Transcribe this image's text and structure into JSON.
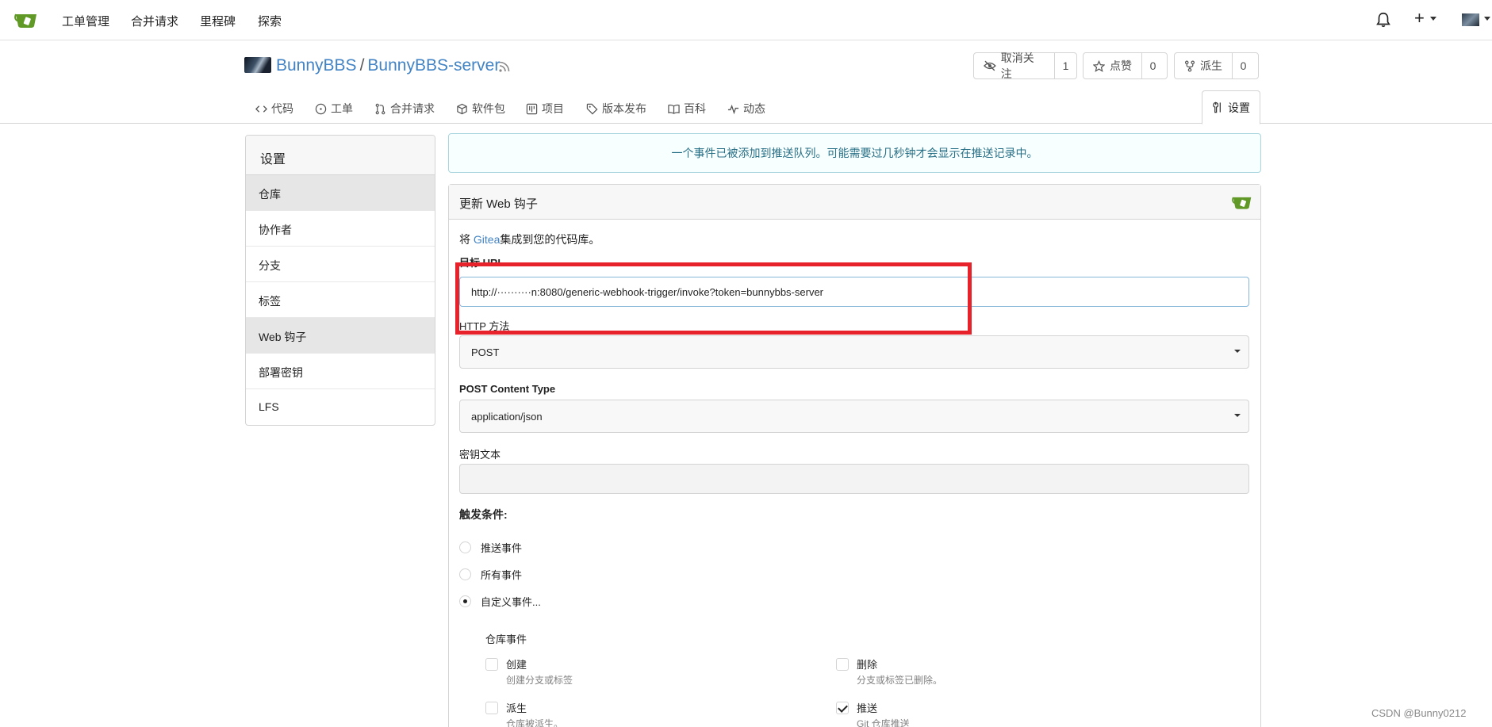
{
  "nav": {
    "items": [
      "工单管理",
      "合并请求",
      "里程碑",
      "探索"
    ]
  },
  "repo": {
    "owner": "BunnyBBS",
    "separator": "/",
    "name": "BunnyBBS-server",
    "unwatch_label": "取消关注",
    "watch_count": "1",
    "star_label": "点赞",
    "star_count": "0",
    "fork_label": "派生",
    "fork_count": "0"
  },
  "tabs": [
    "代码",
    "工单",
    "合并请求",
    "软件包",
    "项目",
    "版本发布",
    "百科",
    "动态"
  ],
  "active_tab": "设置",
  "sidebar": {
    "title": "设置",
    "items": [
      "仓库",
      "协作者",
      "分支",
      "标签",
      "Web 钩子",
      "部署密钥",
      "LFS"
    ]
  },
  "message": "一个事件已被添加到推送队列。可能需要过几秒钟才会显示在推送记录中。",
  "form": {
    "title": "更新 Web 钩子",
    "desc_prefix": "将 ",
    "desc_link": "Gitea",
    "desc_suffix": "集成到您的代码库。",
    "url_label": "目标 URL",
    "url_value": "http://··········n:8080/generic-webhook-trigger/invoke?token=bunnybbs-server",
    "method_label": "HTTP 方法",
    "method_value": "POST",
    "content_type_label": "POST Content Type",
    "content_type_value": "application/json",
    "secret_label": "密钥文本",
    "secret_value": "",
    "trigger_label": "触发条件:",
    "trigger_options": [
      "推送事件",
      "所有事件",
      "自定义事件..."
    ],
    "repo_events_title": "仓库事件",
    "events": [
      {
        "name": "创建",
        "desc": "创建分支或标签",
        "checked": false
      },
      {
        "name": "删除",
        "desc": "分支或标签已删除。",
        "checked": false
      },
      {
        "name": "派生",
        "desc": "仓库被派生。",
        "checked": false
      },
      {
        "name": "推送",
        "desc": "Git 仓库推送",
        "checked": true
      }
    ]
  },
  "watermark": "CSDN @Bunny0212",
  "colors": {
    "link": "#4183c4",
    "highlight": "#e8222a",
    "brand": "#609926",
    "info_text": "#276f86"
  }
}
